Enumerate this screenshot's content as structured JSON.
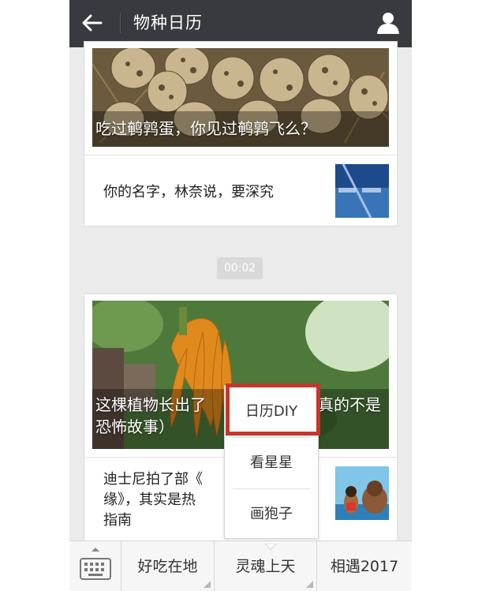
{
  "header": {
    "title": "物种日历",
    "back_icon": "arrow-left-icon",
    "user_icon": "person-icon"
  },
  "feed": {
    "card1": {
      "caption": "吃过鹌鹑蛋，你见过鹌鹑飞么？",
      "row_text": "你的名字，林奈说，要深究"
    },
    "timestamp": "00:02",
    "card2": {
      "caption_line1": "这棵植物长出了",
      "caption_line1_tail": "真的不是",
      "caption_line2": "恐怖故事）",
      "row_line1": "迪士尼拍了部《",
      "row_line2": "缘》，其实是热",
      "row_line3": "指南"
    }
  },
  "bottom_menu": {
    "keyboard_icon": "keyboard-icon",
    "items": [
      {
        "label": "好吃在地"
      },
      {
        "label": "灵魂上天"
      },
      {
        "label": "相遇2017"
      }
    ]
  },
  "popup_menu": {
    "items": [
      {
        "label": "日历DIY"
      },
      {
        "label": "看星星"
      },
      {
        "label": "画狍子"
      }
    ]
  },
  "colors": {
    "header_bg": "#393a3f",
    "highlight": "#c6362a",
    "chat_bg": "#ebebeb"
  }
}
